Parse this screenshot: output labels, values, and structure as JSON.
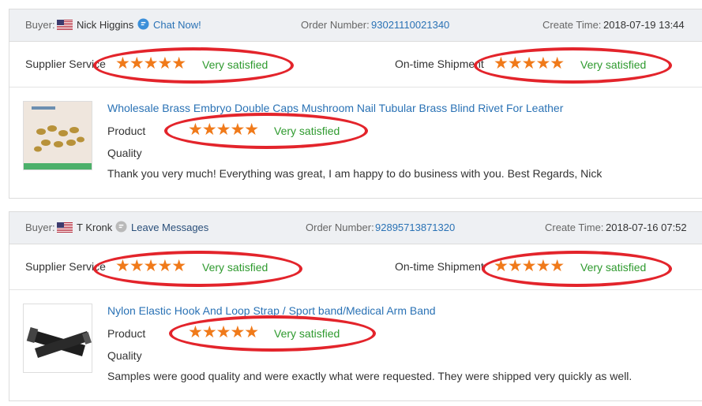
{
  "colors": {
    "star": "#f07a1a",
    "verdict_green": "#2e9a2e",
    "link_blue": "#2a72b5",
    "annotation_red": "#e3242b"
  },
  "reviews": [
    {
      "buyer_label": "Buyer:",
      "buyer_flag": "us-flag-icon",
      "buyer_name": "Nick Higgins",
      "contact_icon": "chat-bubble-icon",
      "contact_label": "Chat Now!",
      "order_label": "Order Number:",
      "order_number": "93021110021340",
      "time_label": "Create Time:",
      "create_time": "2018-07-19 13:44",
      "supplier_label": "Supplier Service",
      "supplier_stars": "★★★★★",
      "supplier_rating_value": 5,
      "supplier_verdict": "Very satisfied",
      "shipment_label": "On-time Shipment",
      "shipment_stars": "★★★★★",
      "shipment_rating_value": 5,
      "shipment_verdict": "Very satisfied",
      "product_title": "Wholesale Brass Embryo Double Caps Mushroom Nail Tubular Brass Blind Rivet For Leather",
      "product_label": "Product",
      "product_stars": "★★★★★",
      "product_rating_value": 5,
      "product_verdict": "Very satisfied",
      "quality_label": "Quality",
      "comment": "Thank you very much! Everything was great, I am happy to do business with you. Best Regards, Nick"
    },
    {
      "buyer_label": "Buyer:",
      "buyer_flag": "us-flag-icon",
      "buyer_name": "T Kronk",
      "contact_icon": "message-bubble-icon",
      "contact_label": "Leave Messages",
      "order_label": "Order Number:",
      "order_number": "92895713871320",
      "time_label": "Create Time:",
      "create_time": "2018-07-16 07:52",
      "supplier_label": "Supplier Service",
      "supplier_stars": "★★★★★",
      "supplier_rating_value": 5,
      "supplier_verdict": "Very satisfied",
      "shipment_label": "On-time Shipment",
      "shipment_stars": "★★★★★",
      "shipment_rating_value": 5,
      "shipment_verdict": "Very satisfied",
      "product_title": "Nylon Elastic Hook And Loop Strap / Sport band/Medical Arm Band",
      "product_label": "Product",
      "product_stars": "★★★★★",
      "product_rating_value": 5,
      "product_verdict": "Very satisfied",
      "quality_label": "Quality",
      "comment": "Samples were good quality and were exactly what were requested. They were shipped very quickly as well."
    }
  ]
}
